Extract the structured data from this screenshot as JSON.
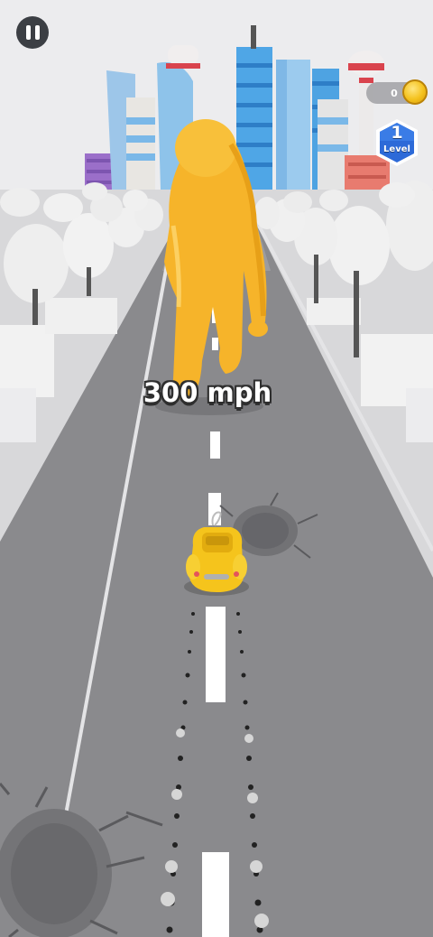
{
  "hud": {
    "pause_icon": "pause-icon",
    "coin_count": "0",
    "coin_icon": "coin-icon",
    "level_number": "1",
    "level_label": "Level"
  },
  "speed": {
    "text": "300 mph"
  },
  "colors": {
    "sky": "#ececee",
    "road": "#8a8a8d",
    "giant": "#f6b42a",
    "car": "#f5c41c",
    "tree_foliage": "#efefef",
    "lane_marking": "#ffffff",
    "level_badge": "#2d6ad8",
    "coin": "#f4c21d"
  }
}
